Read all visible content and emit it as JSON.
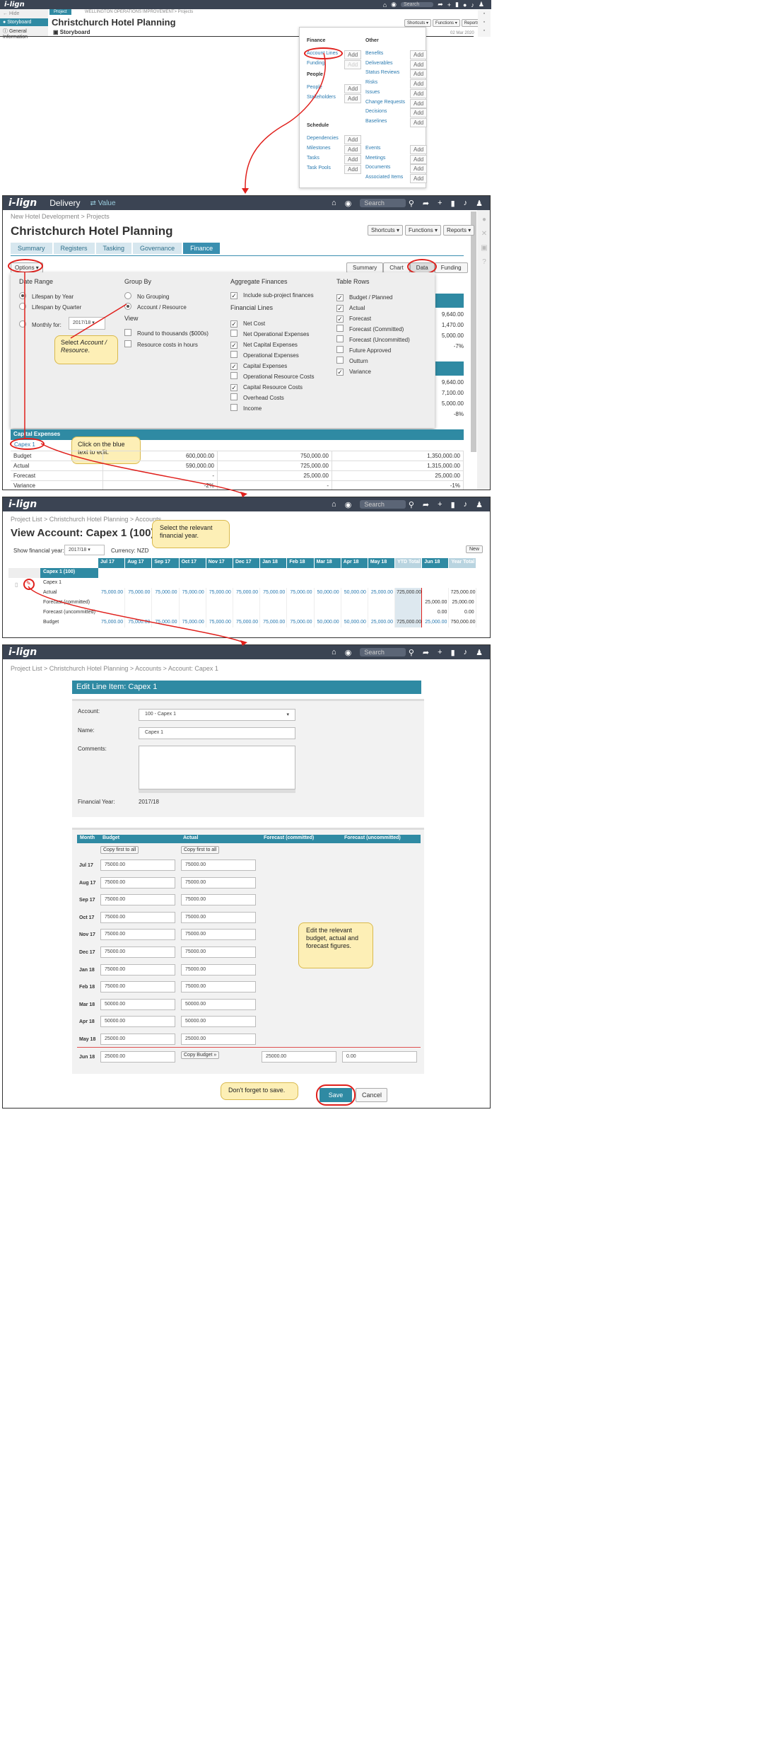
{
  "panel1": {
    "logo": "i-lign",
    "project_badge": "Project",
    "hide": "Hide",
    "storyboard": "Storyboard",
    "general_info": "General Information",
    "breadcrumb": "WELLINGTON OPERATIONS IMPROVEMENT> Projects",
    "title": "Christchurch Hotel Planning",
    "subtitle": "Storyboard",
    "search": "Search",
    "shortcuts": "Shortcuts",
    "functions": "Functions",
    "reports": "Reports",
    "date": "02 Mar 2020"
  },
  "menu": {
    "finance_head": "Finance",
    "account_lines": "Account Lines",
    "funding": "Funding",
    "people_head": "People",
    "people": "People",
    "stakeholders": "Stakeholders",
    "schedule_head": "Schedule",
    "dependencies": "Dependencies",
    "milestones": "Milestones",
    "tasks": "Tasks",
    "task_pools": "Task Pools",
    "other_head": "Other",
    "benefits": "Benefits",
    "deliverables": "Deliverables",
    "status_reviews": "Status Reviews",
    "risks": "Risks",
    "issues": "Issues",
    "change_requests": "Change Requests",
    "decisions": "Decisions",
    "baselines": "Baselines",
    "events": "Events",
    "meetings": "Meetings",
    "documents": "Documents",
    "associated_items": "Associated Items",
    "add": "Add"
  },
  "panel2": {
    "logo": "i-lign",
    "delivery": "Delivery",
    "value": "Value",
    "search": "Search",
    "breadcrumb": "New Hotel Development > Projects",
    "title": "Christchurch Hotel Planning",
    "shortcuts": "Shortcuts",
    "functions": "Functions",
    "reports": "Reports",
    "tabs": [
      "Summary",
      "Registers",
      "Tasking",
      "Governance",
      "Finance"
    ],
    "options": "Options",
    "views": [
      "Summary",
      "Chart",
      "Data",
      "Funding"
    ],
    "date_range_head": "Date Range",
    "lifespan_year": "Lifespan by Year",
    "lifespan_quarter": "Lifespan by Quarter",
    "monthly_for": "Monthly for:",
    "monthly_value": "2017/18",
    "group_by_head": "Group By",
    "no_grouping": "No Grouping",
    "account_resource": "Account / Resource",
    "view_head": "View",
    "round_thousands": "Round to thousands ($000s)",
    "resource_hours": "Resource costs in hours",
    "aggregate_head": "Aggregate Finances",
    "include_sub": "Include sub-project finances",
    "financial_lines_head": "Financial Lines",
    "fin_lines": [
      "Net Cost",
      "Net Operational Expenses",
      "Net Capital Expenses",
      "Operational Expenses",
      "Capital Expenses",
      "Operational Resource Costs",
      "Capital Resource Costs",
      "Overhead Costs",
      "Income"
    ],
    "table_rows_head": "Table Rows",
    "table_rows": [
      "Budget / Planned",
      "Actual",
      "Forecast",
      "Forecast (Committed)",
      "Forecast (Uncommitted)",
      "Future Approved",
      "Outturn",
      "Variance"
    ],
    "callout_select_1": "Select ",
    "callout_select_em": "Account / Resource",
    "callout_select_2": ".",
    "right_vals": [
      "9,640.00",
      "1,470.00",
      "5,000.00",
      "-7%",
      "9,640.00",
      "7,100.00",
      "5,000.00",
      "-8%"
    ],
    "capex_head": "Capital Expenses",
    "capex_link": "Capex 1",
    "callout_click": "Click on the blue text to edit.",
    "rows": [
      {
        "label": "Budget",
        "c1": "600,000.00",
        "c2": "750,000.00",
        "c3": "1,350,000.00"
      },
      {
        "label": "Actual",
        "c1": "590,000.00",
        "c2": "725,000.00",
        "c3": "1,315,000.00"
      },
      {
        "label": "Forecast",
        "c1": "-",
        "c2": "25,000.00",
        "c3": "25,000.00"
      },
      {
        "label": "Variance",
        "c1": "-2%",
        "c2": "-",
        "c3": "-1%"
      }
    ]
  },
  "panel3": {
    "breadcrumb": "Project List > Christchurch Hotel Planning > Accounts",
    "title": "View Account: Capex 1 (100)",
    "callout": "Select the relevant financial year.",
    "show_fy": "Show financial year:",
    "fy": "2017/18",
    "currency": "Currency: NZD",
    "new": "New",
    "months": [
      "Jul 17",
      "Aug 17",
      "Sep 17",
      "Oct 17",
      "Nov 17",
      "Dec 17",
      "Jan 18",
      "Feb 18",
      "Mar 18",
      "Apr 18",
      "May 18",
      "YTD Total",
      "Jun 18",
      "Year Total"
    ],
    "account_head": "Capex 1 (100)",
    "account_name": "Capex 1",
    "rows": [
      {
        "label": "Actual",
        "vals": [
          "75,000.00",
          "75,000.00",
          "75,000.00",
          "75,000.00",
          "75,000.00",
          "75,000.00",
          "75,000.00",
          "75,000.00",
          "50,000.00",
          "50,000.00",
          "25,000.00",
          "725,000.00",
          "",
          "725,000.00"
        ]
      },
      {
        "label": "Forecast (committed)",
        "vals": [
          "",
          "",
          "",
          "",
          "",
          "",
          "",
          "",
          "",
          "",
          "",
          "",
          "25,000.00",
          "25,000.00"
        ]
      },
      {
        "label": "Forecast (uncommitted)",
        "vals": [
          "",
          "",
          "",
          "",
          "",
          "",
          "",
          "",
          "",
          "",
          "",
          "",
          "0.00",
          "0.00"
        ]
      },
      {
        "label": "Budget",
        "vals": [
          "75,000.00",
          "75,000.00",
          "75,000.00",
          "75,000.00",
          "75,000.00",
          "75,000.00",
          "75,000.00",
          "75,000.00",
          "50,000.00",
          "50,000.00",
          "25,000.00",
          "725,000.00",
          "25,000.00",
          "750,000.00"
        ]
      }
    ]
  },
  "panel4": {
    "breadcrumb": "Project List > Christchurch Hotel Planning > Accounts > Account: Capex 1",
    "form_title": "Edit Line Item: Capex 1",
    "account_label": "Account:",
    "account_value": "100 - Capex 1",
    "name_label": "Name:",
    "name_value": "Capex 1",
    "comments_label": "Comments:",
    "fy_label": "Financial Year:",
    "fy_value": "2017/18",
    "cols": [
      "Month",
      "Budget",
      "Actual",
      "Forecast (committed)",
      "Forecast (uncommitted)"
    ],
    "copy_first": "Copy first to all",
    "copy_budget": "Copy Budget »",
    "months": [
      {
        "m": "Jul 17",
        "b": "75000.00",
        "a": "75000.00"
      },
      {
        "m": "Aug 17",
        "b": "75000.00",
        "a": "75000.00"
      },
      {
        "m": "Sep 17",
        "b": "75000.00",
        "a": "75000.00"
      },
      {
        "m": "Oct 17",
        "b": "75000.00",
        "a": "75000.00"
      },
      {
        "m": "Nov 17",
        "b": "75000.00",
        "a": "75000.00"
      },
      {
        "m": "Dec 17",
        "b": "75000.00",
        "a": "75000.00"
      },
      {
        "m": "Jan 18",
        "b": "75000.00",
        "a": "75000.00"
      },
      {
        "m": "Feb 18",
        "b": "75000.00",
        "a": "75000.00"
      },
      {
        "m": "Mar 18",
        "b": "50000.00",
        "a": "50000.00"
      },
      {
        "m": "Apr 18",
        "b": "50000.00",
        "a": "50000.00"
      },
      {
        "m": "May 18",
        "b": "25000.00",
        "a": "25000.00"
      }
    ],
    "jun": {
      "m": "Jun 18",
      "b": "25000.00",
      "fc": "25000.00",
      "fu": "0.00"
    },
    "callout_edit": "Edit the relevant budget, actual and forecast figures.",
    "callout_save": "Don't forget to save.",
    "save": "Save",
    "cancel": "Cancel"
  }
}
